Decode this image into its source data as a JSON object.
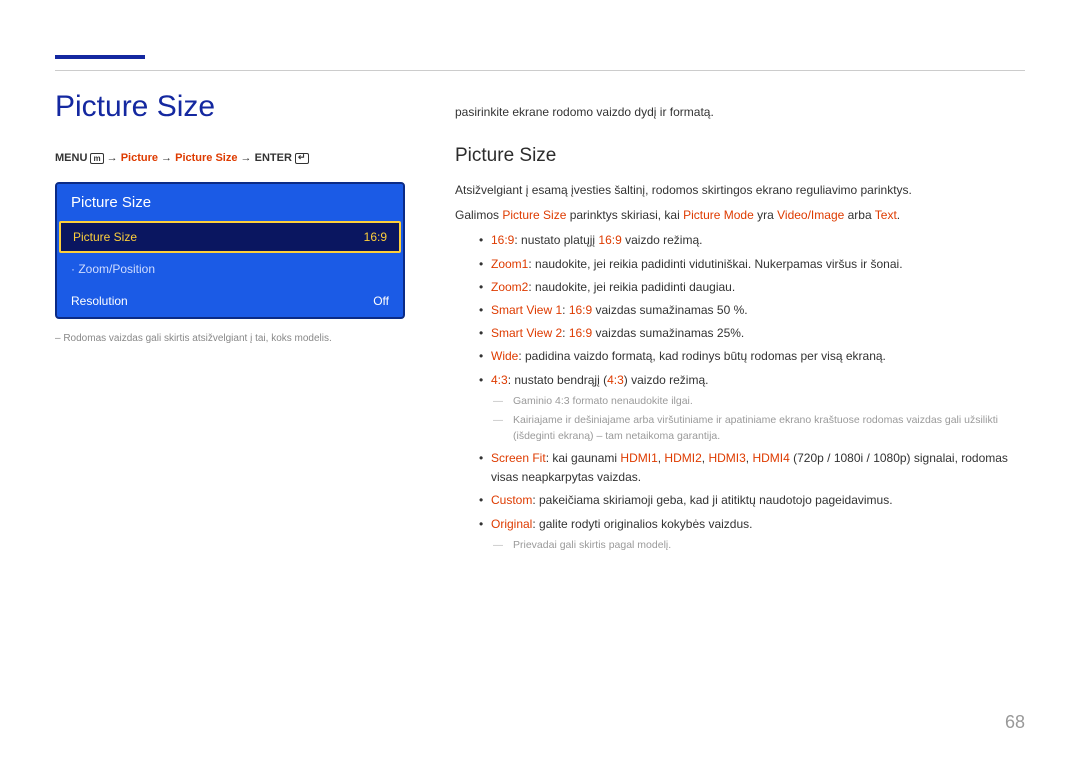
{
  "pageNumber": "68",
  "left": {
    "title": "Picture Size",
    "breadcrumb": {
      "menu": "MENU",
      "picture": "Picture",
      "pictureSize": "Picture Size",
      "enter": "ENTER"
    },
    "menuBox": {
      "header": "Picture Size",
      "row1_label": "Picture Size",
      "row1_value": "16:9",
      "row2_label": "· Zoom/Position",
      "row3_label": "Resolution",
      "row3_value": "Off"
    },
    "note": "– Rodomas vaizdas gali skirtis atsižvelgiant į tai, koks modelis."
  },
  "right": {
    "intro": "pasirinkite ekrane rodomo vaizdo dydį ir formatą.",
    "subtitle": "Picture Size",
    "p1": "Atsižvelgiant į esamą įvesties šaltinį, rodomos skirtingos ekrano reguliavimo parinktys.",
    "p2_a": "Galimos ",
    "p2_b": "Picture Size",
    "p2_c": " parinktys skiriasi, kai ",
    "p2_d": "Picture Mode",
    "p2_e": " yra ",
    "p2_f": "Video/Image",
    "p2_g": " arba ",
    "p2_h": "Text",
    "p2_i": ".",
    "b1_a": "16:9",
    "b1_b": ": nustato platųjį ",
    "b1_c": "16:9",
    "b1_d": " vaizdo režimą.",
    "b2_a": "Zoom1",
    "b2_b": ": naudokite, jei reikia padidinti vidutiniškai. Nukerpamas viršus ir šonai.",
    "b3_a": "Zoom2",
    "b3_b": ": naudokite, jei reikia padidinti daugiau.",
    "b4_a": "Smart View 1",
    "b4_b": ": ",
    "b4_c": "16:9",
    "b4_d": " vaizdas sumažinamas 50 %.",
    "b5_a": "Smart View 2",
    "b5_b": ": ",
    "b5_c": "16:9",
    "b5_d": " vaizdas sumažinamas 25%.",
    "b6_a": "Wide",
    "b6_b": ": padidina vaizdo formatą, kad rodinys būtų rodomas per visą ekraną.",
    "b7_a": "4:3",
    "b7_b": ": nustato bendrąjį (",
    "b7_c": "4:3",
    "b7_d": ") vaizdo režimą.",
    "n7a_a": "Gaminio ",
    "n7a_b": "4:3",
    "n7a_c": " formato nenaudokite ilgai.",
    "n7b": "Kairiajame ir dešiniajame arba viršutiniame ir apatiniame ekrano kraštuose rodomas vaizdas gali užsilikti (išdeginti ekraną) – tam netaikoma garantija.",
    "b8_a": "Screen Fit",
    "b8_b": ": kai gaunami ",
    "b8_c": "HDMI1",
    "b8_d": ", ",
    "b8_e": "HDMI2",
    "b8_f": ", ",
    "b8_g": "HDMI3",
    "b8_h": ", ",
    "b8_i": "HDMI4",
    "b8_j": " (720p / 1080i / 1080p) signalai, rodomas visas neapkarpytas vaizdas.",
    "b9_a": "Custom",
    "b9_b": ": pakeičiama skiriamoji geba, kad ji atitiktų naudotojo pageidavimus.",
    "b10_a": "Original",
    "b10_b": ": galite rodyti originalios kokybės vaizdus.",
    "n10": "Prievadai gali skirtis pagal modelį."
  }
}
